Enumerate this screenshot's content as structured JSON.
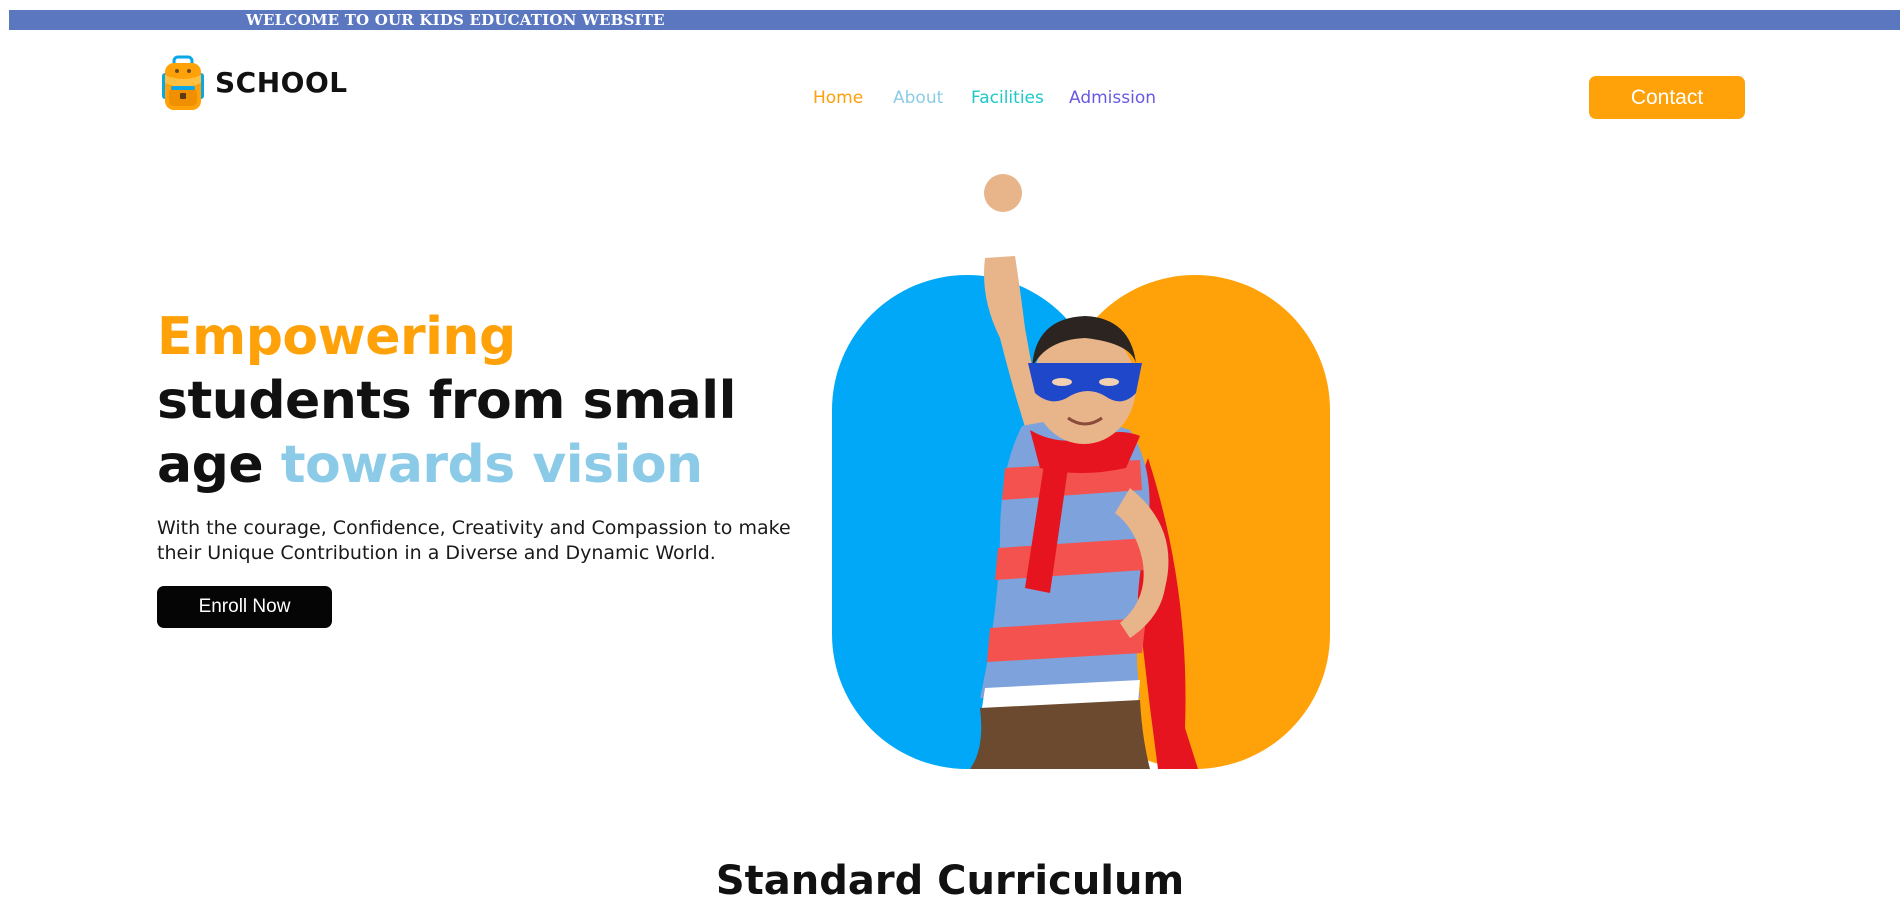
{
  "banner": {
    "text": "WELCOME TO OUR KIDS EDUCATION WEBSITE",
    "color": "#5a77bf"
  },
  "brand": {
    "name": "SCHOOL",
    "icon": "backpack-icon"
  },
  "nav": {
    "items": [
      {
        "label": "Home",
        "color": "#ff9f0a"
      },
      {
        "label": "About",
        "color": "#8ccce6"
      },
      {
        "label": "Facilities",
        "color": "#1dc9c9"
      },
      {
        "label": "Admission",
        "color": "#6759e6"
      }
    ]
  },
  "header": {
    "contact_label": "Contact",
    "contact_color": "#ffa20a"
  },
  "hero": {
    "title_orange": "Empowering",
    "title_line2": "students from small",
    "title_line3_prefix": "age",
    "title_blue": "towards vision",
    "description": "With the courage, Confidence, Creativity and Compassion to make their Unique Contribution in a Diverse and Dynamic World.",
    "enroll_label": "Enroll Now",
    "image": "superhero-kid-image",
    "accent_blue": "#00a8f7",
    "accent_orange": "#ffa20a"
  },
  "curriculum": {
    "heading": "Standard Curriculum"
  }
}
